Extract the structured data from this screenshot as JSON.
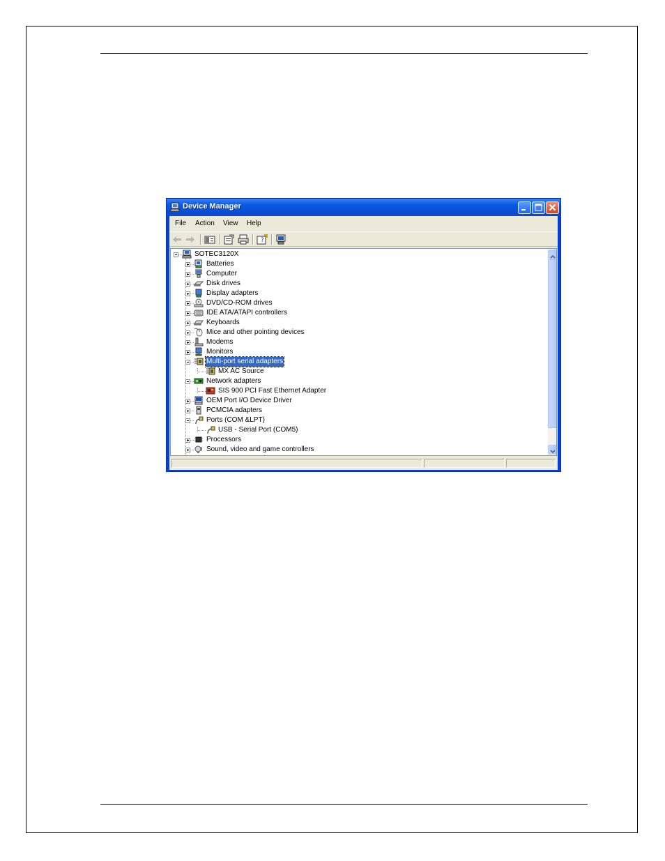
{
  "window": {
    "title": "Device Manager",
    "menu": [
      "File",
      "Action",
      "View",
      "Help"
    ]
  },
  "tree": {
    "root": "SOTEC3120X",
    "items": [
      {
        "label": "Batteries",
        "icon": "battery-icon",
        "state": "collapsed"
      },
      {
        "label": "Computer",
        "icon": "computer-icon",
        "state": "collapsed"
      },
      {
        "label": "Disk drives",
        "icon": "disk-drive-icon",
        "state": "collapsed"
      },
      {
        "label": "Display adapters",
        "icon": "display-adapter-icon",
        "state": "collapsed"
      },
      {
        "label": "DVD/CD-ROM drives",
        "icon": "cdrom-icon",
        "state": "collapsed"
      },
      {
        "label": "IDE ATA/ATAPI controllers",
        "icon": "ide-controller-icon",
        "state": "collapsed"
      },
      {
        "label": "Keyboards",
        "icon": "keyboard-icon",
        "state": "collapsed"
      },
      {
        "label": "Mice and other pointing devices",
        "icon": "mouse-icon",
        "state": "collapsed"
      },
      {
        "label": "Modems",
        "icon": "modem-icon",
        "state": "collapsed"
      },
      {
        "label": "Monitors",
        "icon": "monitor-icon",
        "state": "collapsed"
      },
      {
        "label": "Multi-port serial adapters",
        "icon": "serial-adapter-icon",
        "state": "expanded",
        "selected": true,
        "children": [
          {
            "label": "MX AC Source",
            "icon": "serial-adapter-icon"
          }
        ]
      },
      {
        "label": "Network adapters",
        "icon": "network-adapter-icon",
        "state": "expanded",
        "children": [
          {
            "label": "SIS 900 PCI Fast Ethernet Adapter",
            "icon": "network-card-icon"
          }
        ]
      },
      {
        "label": "OEM Port I/O Device Driver",
        "icon": "port-driver-icon",
        "state": "collapsed"
      },
      {
        "label": "PCMCIA adapters",
        "icon": "pcmcia-icon",
        "state": "collapsed"
      },
      {
        "label": "Ports (COM &LPT)",
        "icon": "port-icon",
        "state": "expanded",
        "children": [
          {
            "label": "USB - Serial Port (COM5)",
            "icon": "port-icon"
          }
        ]
      },
      {
        "label": "Processors",
        "icon": "processor-icon",
        "state": "collapsed"
      },
      {
        "label": "Sound, video and game controllers",
        "icon": "sound-icon",
        "state": "collapsed"
      }
    ]
  },
  "colors": {
    "title_bar": "#0a4fd8",
    "selection": "#316ac5",
    "close_button": "#d34719"
  }
}
